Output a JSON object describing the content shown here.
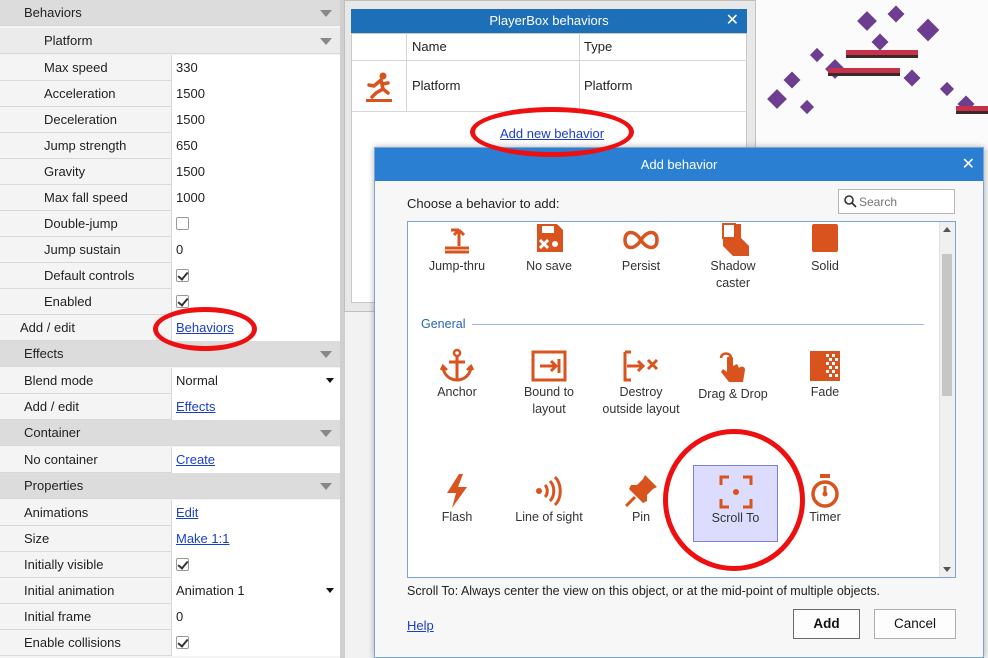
{
  "props": {
    "behaviors_header": "Behaviors",
    "platform_header": "Platform",
    "platform_rows": [
      {
        "key": "Max speed",
        "value": "330"
      },
      {
        "key": "Acceleration",
        "value": "1500"
      },
      {
        "key": "Deceleration",
        "value": "1500"
      },
      {
        "key": "Jump strength",
        "value": "650"
      },
      {
        "key": "Gravity",
        "value": "1500"
      },
      {
        "key": "Max fall speed",
        "value": "1000"
      },
      {
        "key": "Double-jump",
        "checked": false
      },
      {
        "key": "Jump sustain",
        "value": "0"
      },
      {
        "key": "Default controls",
        "checked": true
      },
      {
        "key": "Enabled",
        "checked": true
      }
    ],
    "add_edit_label": "Add / edit",
    "behaviors_link": "Behaviors",
    "effects_header": "Effects",
    "blend_mode_label": "Blend mode",
    "blend_mode_value": "Normal",
    "effects_add_edit_label": "Add / edit",
    "effects_link": "Effects",
    "container_header": "Container",
    "no_container_label": "No container",
    "create_link": "Create",
    "properties_header": "Properties",
    "animations_label": "Animations",
    "animations_link": "Edit",
    "size_label": "Size",
    "size_link": "Make 1:1",
    "initially_visible_label": "Initially visible",
    "initially_visible": true,
    "initial_animation_label": "Initial animation",
    "initial_animation_value": "Animation 1",
    "initial_frame_label": "Initial frame",
    "initial_frame_value": "0",
    "enable_collisions_label": "Enable collisions",
    "enable_collisions": true
  },
  "playerbox_dialog": {
    "title": "PlayerBox behaviors",
    "col_name": "Name",
    "col_type": "Type",
    "row_name": "Platform",
    "row_type": "Platform",
    "add_link": "Add new behavior"
  },
  "add_dialog": {
    "title": "Add behavior",
    "prompt": "Choose a behavior to add:",
    "search_placeholder": "Search",
    "row1": [
      {
        "label": "Jump-thru",
        "icon": "jump-thru-icon"
      },
      {
        "label": "No save",
        "icon": "no-save-icon"
      },
      {
        "label": "Persist",
        "icon": "persist-icon"
      },
      {
        "label": "Shadow caster",
        "icon": "shadow-caster-icon"
      },
      {
        "label": "Solid",
        "icon": "solid-icon"
      }
    ],
    "general_label": "General",
    "row2": [
      {
        "label": "Anchor",
        "icon": "anchor-icon"
      },
      {
        "label": "Bound to layout",
        "icon": "bound-to-layout-icon"
      },
      {
        "label": "Destroy outside layout",
        "icon": "destroy-outside-layout-icon"
      },
      {
        "label": "Drag & Drop",
        "icon": "drag-drop-icon"
      },
      {
        "label": "Fade",
        "icon": "fade-icon"
      }
    ],
    "row3": [
      {
        "label": "Flash",
        "icon": "flash-icon"
      },
      {
        "label": "Line of sight",
        "icon": "line-of-sight-icon"
      },
      {
        "label": "Pin",
        "icon": "pin-icon"
      },
      {
        "label": "Scroll To",
        "icon": "scroll-to-icon",
        "selected": true
      },
      {
        "label": "Timer",
        "icon": "timer-icon"
      }
    ],
    "description": "Scroll To: Always center the view on this object, or at the mid-point of multiple objects.",
    "help_link": "Help",
    "add_button": "Add",
    "cancel_button": "Cancel"
  },
  "colors": {
    "icon_orange": "#d9531e",
    "title_bar": "#2a7fd3",
    "annotation_red": "#ee1010",
    "selection": "#dcdcff"
  }
}
